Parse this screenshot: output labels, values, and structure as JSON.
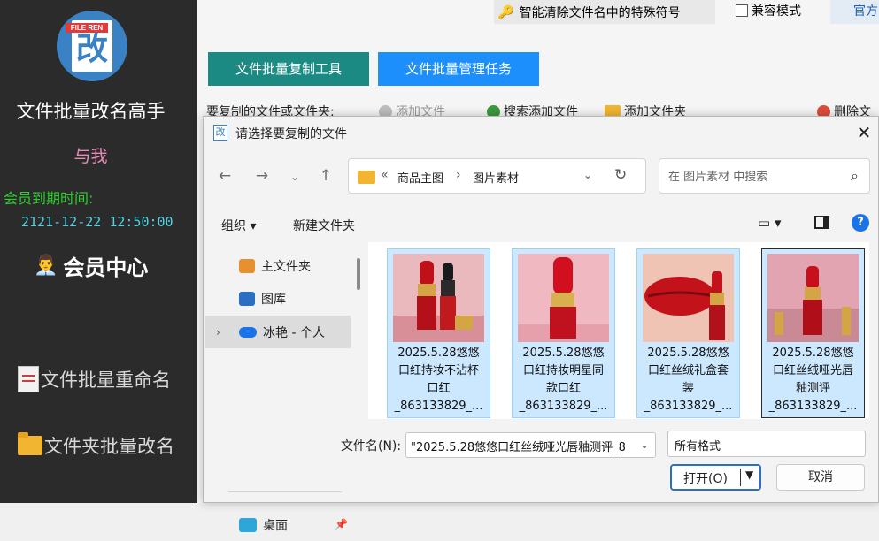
{
  "sidebar": {
    "logo_tag": "FILE REN",
    "logo_glyph": "改",
    "app_title": "文件批量改名高手",
    "with_me": "与我",
    "member_expire_label": "会员到期时间:",
    "member_expire_date": "2121-12-22 12:50:00",
    "member_center": "会员中心",
    "nav_rename": "文件批量重命名",
    "nav_folder": "文件夹批量改名"
  },
  "main": {
    "special_char": "智能清除文件名中的特殊符号",
    "compat_label": "兼容模式",
    "official": "官方",
    "tab_copy": "文件批量复制工具",
    "tab_manage": "文件批量管理任务",
    "copy_label": "要复制的文件或文件夹:",
    "add_file": "添加文件",
    "search_add": "搜索添加文件",
    "add_folder": "添加文件夹",
    "delete_files": "删除文"
  },
  "dialog": {
    "title_icon": "改",
    "title": "请选择要复制的文件",
    "address": {
      "crumb1": "商品主图",
      "crumb2": "图片素材"
    },
    "search_placeholder": "在 图片素材 中搜索",
    "toolbar": {
      "organize": "组织 ▾",
      "new_folder": "新建文件夹",
      "help": "?"
    },
    "nav": [
      {
        "label": "主文件夹"
      },
      {
        "label": "图库"
      },
      {
        "label": "冰艳 - 个人"
      },
      {
        "label": "桌面"
      }
    ],
    "files": [
      {
        "line1": "2025.5.28悠悠",
        "line2": "口红持妆不沾杯",
        "line3": "口红",
        "line4": "_863133829_..."
      },
      {
        "line1": "2025.5.28悠悠",
        "line2": "口红持妆明星同",
        "line3": "款口红",
        "line4": "_863133829_..."
      },
      {
        "line1": "2025.5.28悠悠",
        "line2": "口红丝绒礼盒套",
        "line3": "装",
        "line4": "_863133829_..."
      },
      {
        "line1": "2025.5.28悠悠",
        "line2": "口红丝绒哑光唇",
        "line3": "釉测评",
        "line4": "_863133829_..."
      }
    ],
    "filename_label": "文件名(N):",
    "filename_value": "\"2025.5.28悠悠口红丝绒哑光唇釉测评_8",
    "filetype": "所有格式",
    "open_label": "打开(O)",
    "cancel_label": "取消"
  },
  "colors": {
    "sidebar_bg": "#2b2b2b",
    "tab_copy_bg": "#1a8a82",
    "tab_manage_bg": "#1d8ffc",
    "selection_bg": "#cce8ff",
    "member_label": "#2bd12b",
    "member_date": "#4fd3e2",
    "with_me": "#e58ab4"
  }
}
